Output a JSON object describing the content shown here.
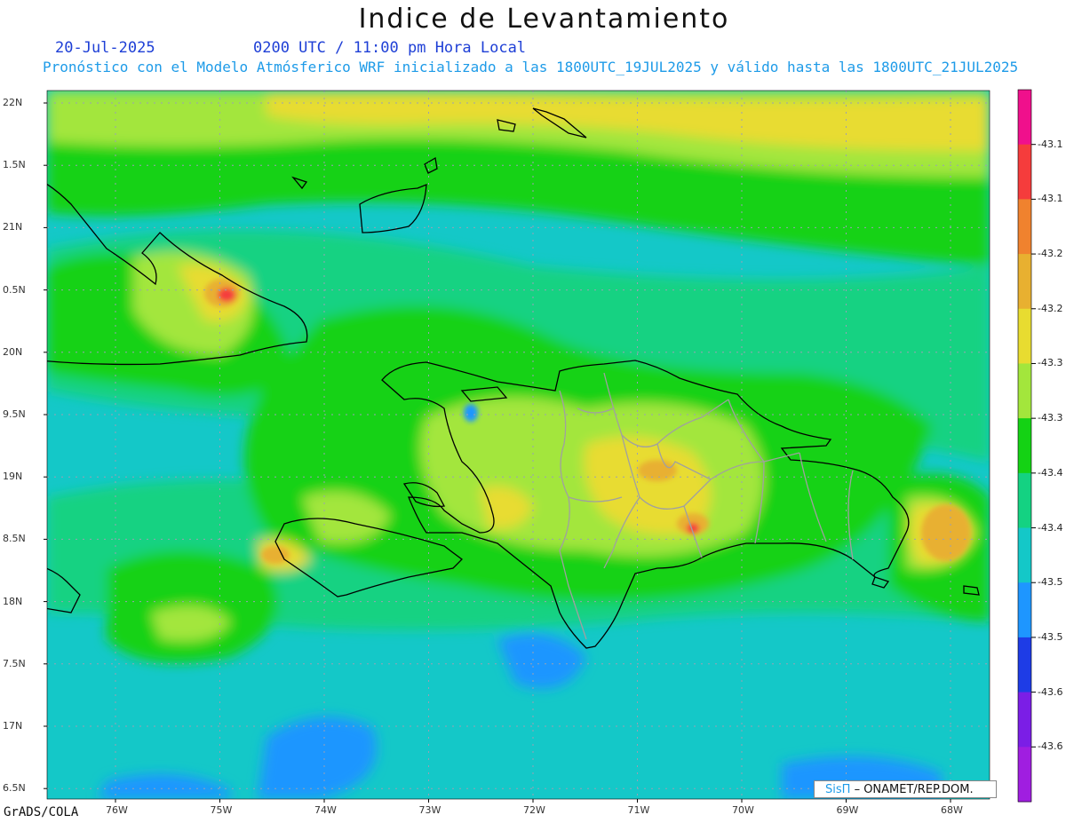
{
  "header": {
    "title": "Indice de Levantamiento",
    "date": "20-Jul-2025",
    "time": "0200 UTC / 11:00 pm Hora Local",
    "subtitle": "Pronóstico con el Modelo Atmósferico WRF inicializado a las 1800UTC_19JUL2025 y válido hasta las  1800UTC_21JUL2025"
  },
  "axes": {
    "lat_labels": [
      "22N",
      "1.5N",
      "21N",
      "0.5N",
      "20N",
      "9.5N",
      "19N",
      "8.5N",
      "18N",
      "7.5N",
      "17N",
      "6.5N"
    ],
    "lon_labels": [
      "76W",
      "75W",
      "74W",
      "73W",
      "72W",
      "71W",
      "70W",
      "69W",
      "68W"
    ]
  },
  "colorbar": {
    "labels": [
      "-43.1",
      "-43.1",
      "-43.2",
      "-43.2",
      "-43.3",
      "-43.3",
      "-43.4",
      "-43.4",
      "-43.5",
      "-43.5",
      "-43.6",
      "-43.6"
    ],
    "colors": [
      "#f0108c",
      "#f53c3c",
      "#f0822e",
      "#e8b030",
      "#e8dc30",
      "#a3e63c",
      "#14d214",
      "#14d282",
      "#14c8c8",
      "#1e96ff",
      "#1e3ce6",
      "#7b1ee6",
      "#a01ee0"
    ]
  },
  "map_colors": {
    "ocean_low": "#1e96ff",
    "ocean": "#14c8c8",
    "mid": "#14d282",
    "green": "#14d214",
    "lime": "#a3e63c",
    "yellow": "#e8dc30",
    "orange": "#e8b030",
    "red": "#f53c3c",
    "coast": "#000000",
    "borders": "#a0a0a0"
  },
  "credit": {
    "logo_text": "SisΠ",
    "text": "– ONAMET/REP.DOM."
  },
  "footer": {
    "software": "GrADS/COLA"
  }
}
